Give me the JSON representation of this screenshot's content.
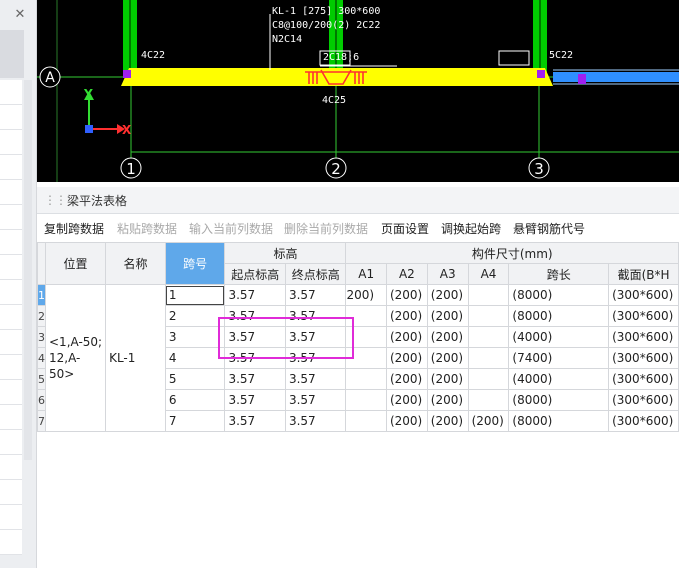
{
  "cad": {
    "axis_a": "A",
    "axis_1": "1",
    "axis_2": "2",
    "axis_3": "3",
    "y_axis": "Y",
    "x_axis": "X",
    "beam_label_line1": "KL-1 [275] 300*600",
    "beam_label_line2": "C8@100/200(2) 2C22",
    "beam_label_line3": "N2C14",
    "top_rebar_left": "4C22",
    "top_rebar_mid": "2C18;6",
    "top_rebar_right": "5C22",
    "bottom_rebar": "4C25",
    "colors": {
      "beam": "#ffff00",
      "column": "#00cc00",
      "grid": "#33cc33",
      "rebar_red": "#ff3030",
      "purple": "#a020f0",
      "blue": "#2f8fff"
    }
  },
  "left_panel": {
    "close_icon": "close-icon"
  },
  "panel": {
    "title": "梁平法表格",
    "toolbar": [
      {
        "label": "复制跨数据",
        "enabled": true
      },
      {
        "label": "粘贴跨数据",
        "enabled": false
      },
      {
        "label": "输入当前列数据",
        "enabled": false
      },
      {
        "label": "删除当前列数据",
        "enabled": false
      },
      {
        "label": "页面设置",
        "enabled": true
      },
      {
        "label": "调换起始跨",
        "enabled": true
      },
      {
        "label": "悬臂钢筋代号",
        "enabled": true
      }
    ]
  },
  "table": {
    "headers": {
      "position": "位置",
      "name": "名称",
      "span": "跨号",
      "elevation": "标高",
      "start_elev": "起点标高",
      "end_elev": "终点标高",
      "component_size": "构件尺寸(mm)",
      "a1": "A1",
      "a2": "A2",
      "a3": "A3",
      "a4": "A4",
      "span_length": "跨长",
      "section": "截面(B*H"
    },
    "position_value": "<1,A-50; 12,A-50>",
    "name_value": "KL-1",
    "rows": [
      {
        "num": "1",
        "span": "1",
        "start": "3.57",
        "end": "3.57",
        "a1": "200)",
        "a2": "(200)",
        "a3": "(200)",
        "a4": "",
        "length": "(8000)",
        "section": "(300*600)"
      },
      {
        "num": "2",
        "span": "2",
        "start": "3.57",
        "end": "3.57",
        "a1": "",
        "a2": "(200)",
        "a3": "(200)",
        "a4": "",
        "length": "(8000)",
        "section": "(300*600)"
      },
      {
        "num": "3",
        "span": "3",
        "start": "3.57",
        "end": "3.57",
        "a1": "",
        "a2": "(200)",
        "a3": "(200)",
        "a4": "",
        "length": "(4000)",
        "section": "(300*600)"
      },
      {
        "num": "4",
        "span": "4",
        "start": "3.57",
        "end": "3.57",
        "a1": "",
        "a2": "(200)",
        "a3": "(200)",
        "a4": "",
        "length": "(7400)",
        "section": "(300*600)"
      },
      {
        "num": "5",
        "span": "5",
        "start": "3.57",
        "end": "3.57",
        "a1": "",
        "a2": "(200)",
        "a3": "(200)",
        "a4": "",
        "length": "(4000)",
        "section": "(300*600)"
      },
      {
        "num": "6",
        "span": "6",
        "start": "3.57",
        "end": "3.57",
        "a1": "",
        "a2": "(200)",
        "a3": "(200)",
        "a4": "",
        "length": "(8000)",
        "section": "(300*600)"
      },
      {
        "num": "7",
        "span": "7",
        "start": "3.57",
        "end": "3.57",
        "a1": "",
        "a2": "(200)",
        "a3": "(200)",
        "a4": "(200)",
        "length": "(8000)",
        "section": "(300*600)"
      }
    ]
  }
}
